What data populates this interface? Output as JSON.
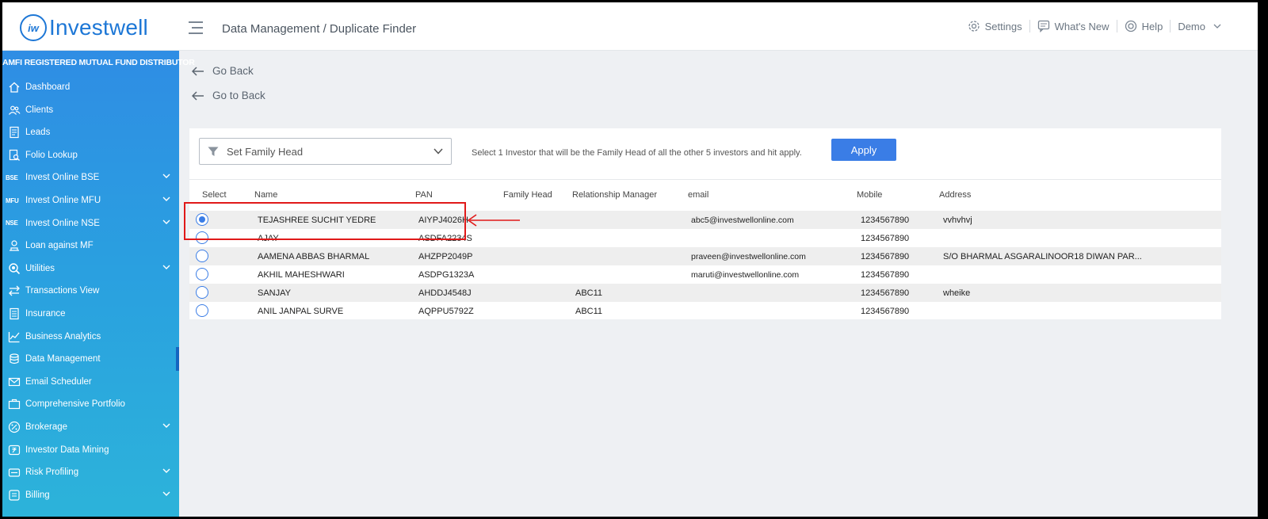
{
  "header": {
    "logo_mark": "iw",
    "logo_text": "Investwell",
    "breadcrumb": "Data Management / Duplicate Finder",
    "settings": "Settings",
    "whats_new": "What's New",
    "help": "Help",
    "user": "Demo"
  },
  "sidebar": {
    "title": "AMFI REGISTERED MUTUAL FUND DISTRIBUTOR",
    "items": [
      {
        "label": "Dashboard",
        "icon": "home-icon"
      },
      {
        "label": "Clients",
        "icon": "users-icon"
      },
      {
        "label": "Leads",
        "icon": "document-icon"
      },
      {
        "label": "Folio Lookup",
        "icon": "folio-search-icon"
      },
      {
        "label": "Invest Online BSE",
        "prefix": "BSE",
        "expandable": true
      },
      {
        "label": "Invest Online MFU",
        "prefix": "MFU",
        "expandable": true
      },
      {
        "label": "Invest Online NSE",
        "prefix": "NSE",
        "expandable": true
      },
      {
        "label": "Loan against MF",
        "icon": "loan-icon"
      },
      {
        "label": "Utilities",
        "icon": "utilities-icon",
        "expandable": true
      },
      {
        "label": "Transactions View",
        "icon": "transfer-icon"
      },
      {
        "label": "Insurance",
        "icon": "insurance-icon"
      },
      {
        "label": "Business Analytics",
        "icon": "analytics-icon"
      },
      {
        "label": "Data Management",
        "icon": "database-icon",
        "active": true
      },
      {
        "label": "Email Scheduler",
        "icon": "email-icon"
      },
      {
        "label": "Comprehensive Portfolio",
        "icon": "portfolio-icon"
      },
      {
        "label": "Brokerage",
        "icon": "percent-icon",
        "expandable": true
      },
      {
        "label": "Investor Data Mining",
        "icon": "rupee-icon"
      },
      {
        "label": "Risk Profiling",
        "icon": "risk-icon",
        "expandable": true
      },
      {
        "label": "Billing",
        "icon": "billing-icon",
        "expandable": true
      }
    ]
  },
  "main": {
    "go_back": "Go Back",
    "go_to_back": "Go to Back",
    "family_head_select": "Set Family Head",
    "instruction": "Select 1 Investor that will be the Family Head of all the other 5 investors and hit apply.",
    "apply": "Apply",
    "columns": [
      "Select",
      "Name",
      "PAN",
      "Family Head",
      "Relationship Manager",
      "email",
      "Mobile",
      "Address"
    ],
    "rows": [
      {
        "selected": true,
        "name": "TEJASHREE SUCHIT YEDRE",
        "pan": "AIYPJ4026H",
        "family_head": "",
        "rm": "",
        "email": "abc5@investwellonline.com",
        "mobile": "1234567890",
        "address": "vvhvhvj"
      },
      {
        "selected": false,
        "name": "AJAY",
        "pan": "ASDFA2234S",
        "family_head": "",
        "rm": "",
        "email": "",
        "mobile": "1234567890",
        "address": ""
      },
      {
        "selected": false,
        "name": "AAMENA ABBAS BHARMAL",
        "pan": "AHZPP2049P",
        "family_head": "",
        "rm": "",
        "email": "praveen@investwellonline.com",
        "mobile": "1234567890",
        "address": "S/O BHARMAL ASGARALINOOR18 DIWAN PAR..."
      },
      {
        "selected": false,
        "name": "AKHIL MAHESHWARI",
        "pan": "ASDPG1323A",
        "family_head": "",
        "rm": "",
        "email": "maruti@investwellonline.com",
        "mobile": "1234567890",
        "address": ""
      },
      {
        "selected": false,
        "name": "SANJAY",
        "pan": "AHDDJ4548J",
        "family_head": "",
        "rm": "ABC11",
        "email": "",
        "mobile": "1234567890",
        "address": "wheike"
      },
      {
        "selected": false,
        "name": "ANIL JANPAL SURVE",
        "pan": "AQPPU5792Z",
        "family_head": "",
        "rm": "ABC11",
        "email": "",
        "mobile": "1234567890",
        "address": ""
      }
    ]
  },
  "colors": {
    "brand": "#1d77d6",
    "accent": "#3a7de6",
    "annotation": "#e01919"
  }
}
